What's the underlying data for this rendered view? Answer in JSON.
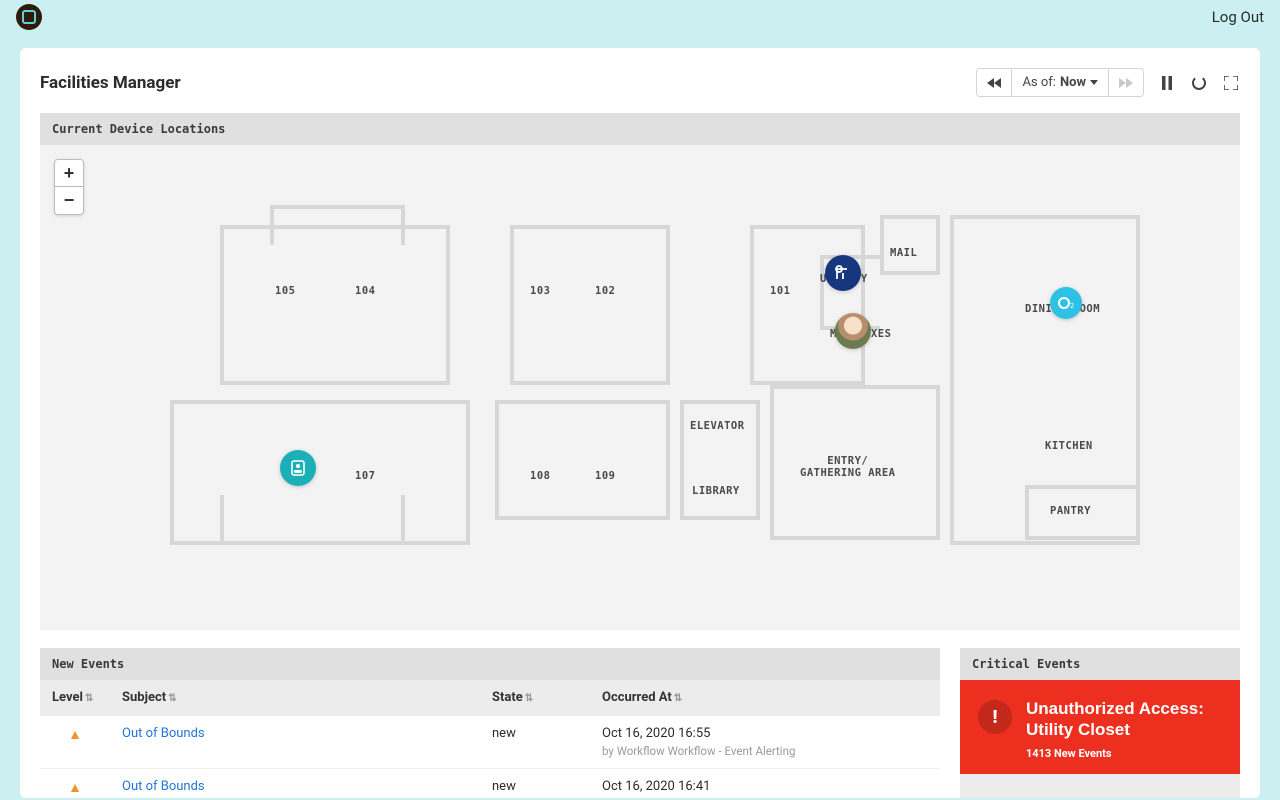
{
  "topbar": {
    "logout": "Log Out"
  },
  "header": {
    "title": "Facilities Manager",
    "asof_prefix": "As of: ",
    "asof_value": "Now"
  },
  "map": {
    "title": "Current Device Locations",
    "zoom_in": "+",
    "zoom_out": "−",
    "rooms": {
      "r105": "105",
      "r104": "104",
      "r103": "103",
      "r102": "102",
      "r101": "101",
      "r107": "107",
      "r108": "108",
      "r109": "109",
      "mail": "MAIL",
      "utility": "UTILITY",
      "mailboxes": "MAILBOXES",
      "dining": "DINING ROOM",
      "elevator": "ELEVATOR",
      "library": "LIBRARY",
      "entry": "ENTRY/\nGATHERING AREA",
      "kitchen": "KITCHEN",
      "pantry": "PANTRY"
    }
  },
  "events": {
    "title": "New Events",
    "cols": {
      "level": "Level",
      "subject": "Subject",
      "state": "State",
      "occurred": "Occurred At"
    },
    "rows": [
      {
        "subject": "Out of Bounds",
        "state": "new",
        "occurred": "Oct 16, 2020 16:55",
        "by": "by Workflow Workflow - Event Alerting"
      },
      {
        "subject": "Out of Bounds",
        "state": "new",
        "occurred": "Oct 16, 2020 16:41",
        "by": ""
      }
    ]
  },
  "critical": {
    "title": "Critical Events",
    "card": {
      "heading": "Unauthorized Access: Utility Closet",
      "sub": "1413 New Events"
    }
  }
}
